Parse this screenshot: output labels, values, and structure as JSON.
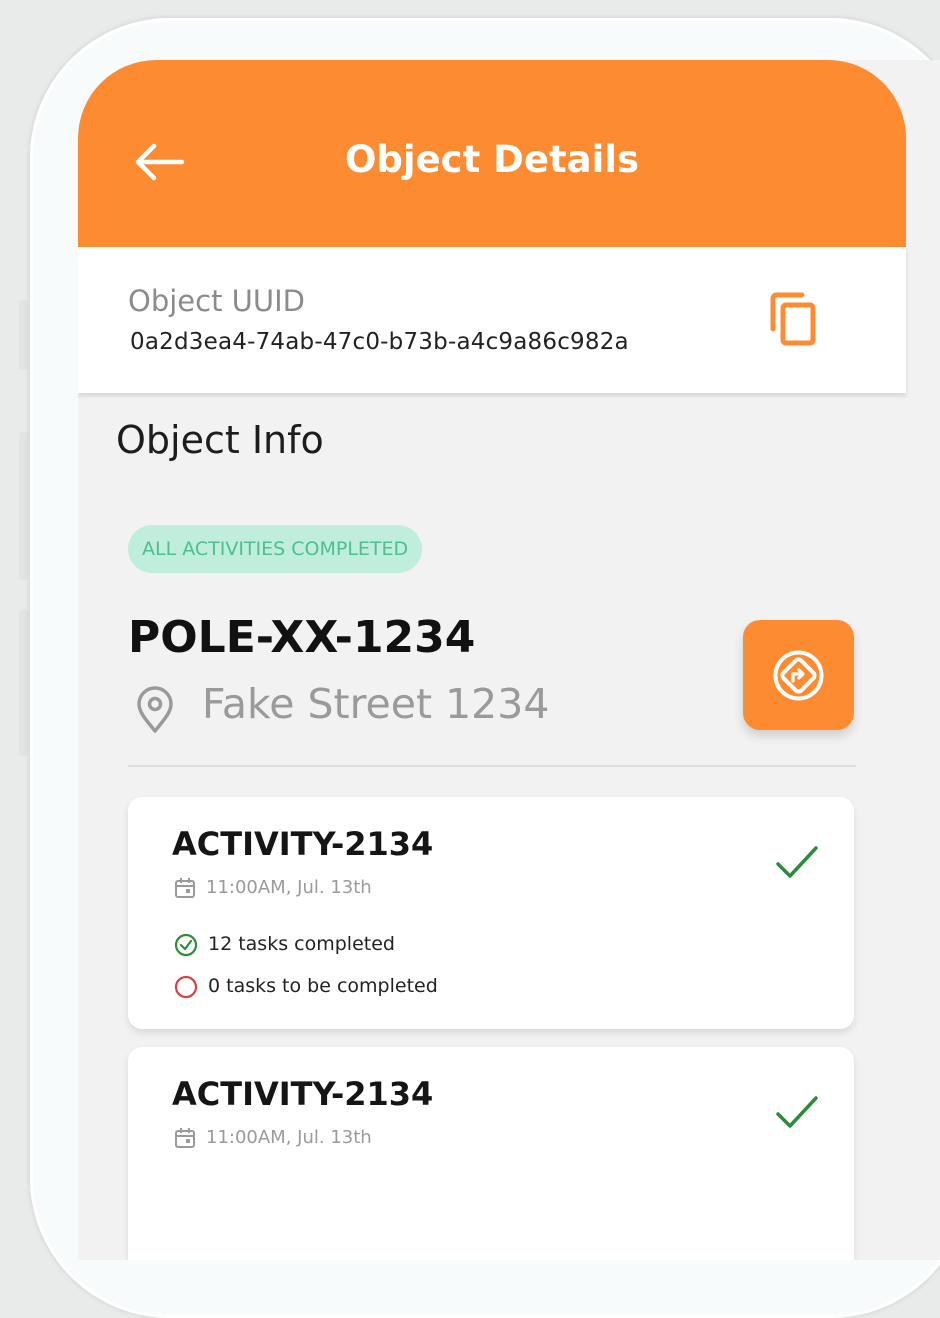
{
  "header": {
    "title": "Object Details",
    "back_icon": "arrow-left-icon"
  },
  "uuid": {
    "label": "Object UUID",
    "value": "0a2d3ea4-74ab-47c0-b73b-a4c9a86c982a",
    "copy_icon": "copy-icon"
  },
  "object_info": {
    "section_title": "Object Info",
    "status_badge": "ALL ACTIVITIES COMPLETED",
    "name": "POLE-XX-1234",
    "address": "Fake Street 1234",
    "location_icon": "location-pin-icon",
    "navigate_icon": "navigation-icon"
  },
  "activities": [
    {
      "title": "ACTIVITY-2134",
      "date": "11:00AM, Jul. 13th",
      "tasks_completed": "12 tasks completed",
      "tasks_pending": "0 tasks to be completed",
      "status_icon": "check-icon"
    },
    {
      "title": "ACTIVITY-2134",
      "date": "11:00AM, Jul. 13th",
      "status_icon": "check-icon"
    }
  ],
  "colors": {
    "accent": "#fd8b31",
    "badge_bg": "#bfeedd",
    "badge_text": "#4fbf8d",
    "success": "#2e8b3a",
    "pending": "#d94040"
  }
}
